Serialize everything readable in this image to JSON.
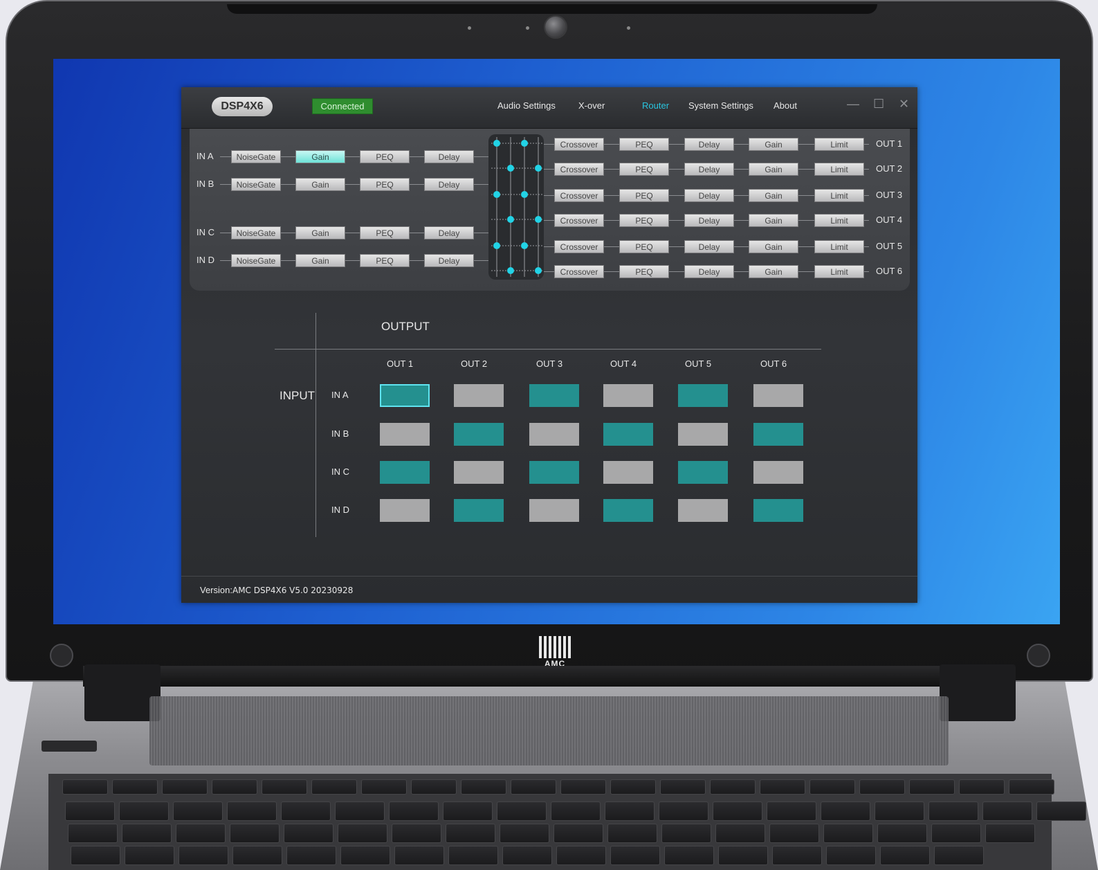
{
  "app": {
    "title": "DSP4X6",
    "status": "Connected",
    "nav": [
      "Audio Settings",
      "X-over",
      "Router",
      "System Settings",
      "About"
    ],
    "active_nav": "Router",
    "window_controls": [
      "minimize-icon",
      "maximize-icon",
      "close-icon"
    ]
  },
  "flow": {
    "inputs": [
      {
        "label": "IN A",
        "blocks": [
          "NoiseGate",
          "Gain",
          "PEQ",
          "Delay"
        ],
        "active_block": "Gain"
      },
      {
        "label": "IN B",
        "blocks": [
          "NoiseGate",
          "Gain",
          "PEQ",
          "Delay"
        ]
      },
      {
        "label": "IN C",
        "blocks": [
          "NoiseGate",
          "Gain",
          "PEQ",
          "Delay"
        ]
      },
      {
        "label": "IN D",
        "blocks": [
          "NoiseGate",
          "Gain",
          "PEQ",
          "Delay"
        ]
      }
    ],
    "outputs": [
      {
        "label": "OUT 1",
        "blocks": [
          "Crossover",
          "PEQ",
          "Delay",
          "Gain",
          "Limit"
        ]
      },
      {
        "label": "OUT 2",
        "blocks": [
          "Crossover",
          "PEQ",
          "Delay",
          "Gain",
          "Limit"
        ]
      },
      {
        "label": "OUT 3",
        "blocks": [
          "Crossover",
          "PEQ",
          "Delay",
          "Gain",
          "Limit"
        ]
      },
      {
        "label": "OUT 4",
        "blocks": [
          "Crossover",
          "PEQ",
          "Delay",
          "Gain",
          "Limit"
        ]
      },
      {
        "label": "OUT 5",
        "blocks": [
          "Crossover",
          "PEQ",
          "Delay",
          "Gain",
          "Limit"
        ]
      },
      {
        "label": "OUT 6",
        "blocks": [
          "Crossover",
          "PEQ",
          "Delay",
          "Gain",
          "Limit"
        ]
      }
    ]
  },
  "router": {
    "output_heading": "OUTPUT",
    "input_heading": "INPUT",
    "columns": [
      "OUT 1",
      "OUT 2",
      "OUT 3",
      "OUT 4",
      "OUT 5",
      "OUT 6"
    ],
    "rows": [
      {
        "label": "IN A",
        "states": [
          1,
          0,
          1,
          0,
          1,
          0
        ]
      },
      {
        "label": "IN B",
        "states": [
          0,
          1,
          0,
          1,
          0,
          1
        ]
      },
      {
        "label": "IN C",
        "states": [
          1,
          0,
          1,
          0,
          1,
          0
        ]
      },
      {
        "label": "IN D",
        "states": [
          0,
          1,
          0,
          1,
          0,
          1
        ]
      }
    ],
    "selected_cell": {
      "row": 0,
      "col": 0
    },
    "on_color": "#24908f",
    "off_color": "#a8a8a9"
  },
  "footer": {
    "version_label": "Version:",
    "version_value": "AMC DSP4X6 V5.0 20230928"
  },
  "device": {
    "brand": "AMC"
  }
}
